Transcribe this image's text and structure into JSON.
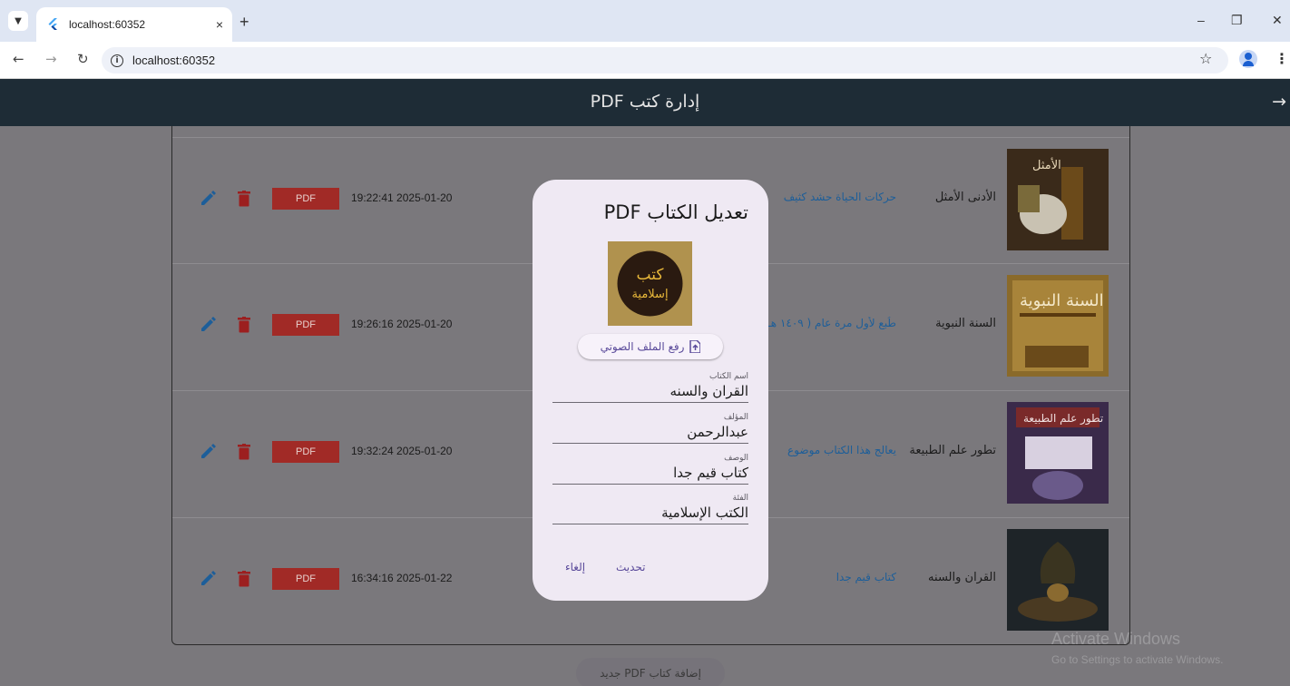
{
  "browser": {
    "tab_title": "localhost:60352",
    "tab_close": "×",
    "new_tab": "+",
    "url": "localhost:60352",
    "minimize": "–",
    "restore": "❐",
    "close": "✕"
  },
  "app": {
    "title": "إدارة كتب PDF",
    "back_arrow": "→"
  },
  "rows": [
    {
      "title": "الأدنى الأمثل",
      "description": "حركات الحياة حشد كثيف",
      "date": "19:22:41 2025-01-20",
      "pdf_label": "PDF"
    },
    {
      "title": "السنة النبوية",
      "description": "طُبع لأول مرة عام ( ١٤٠٩ هـ",
      "date": "19:26:16 2025-01-20",
      "pdf_label": "PDF"
    },
    {
      "title": "تطور علم الطبيعة",
      "description": "يعالج هذا الكتاب موضوع",
      "date": "19:32:24 2025-01-20",
      "pdf_label": "PDF"
    },
    {
      "title": "القران والسنه",
      "description": "كتاب قيم جدا",
      "date": "16:34:16 2025-01-22",
      "pdf_label": "PDF"
    }
  ],
  "add_button": "إضافة كتاب PDF جديد",
  "watermark": {
    "line1": "Activate Windows",
    "line2": "Go to Settings to activate Windows."
  },
  "dialog": {
    "title": "تعديل الكتاب PDF",
    "cover_text_line1": "كتب",
    "cover_text_line2": "إسلامية",
    "upload_label": "رفع الملف الصوتي",
    "fields": {
      "name": {
        "label": "اسم الكتاب",
        "value": "القران والسنه"
      },
      "author": {
        "label": "المؤلف",
        "value": "عبدالرحمن"
      },
      "description": {
        "label": "الوصف",
        "value": "كتاب قيم جدا"
      },
      "category": {
        "label": "الفئة",
        "value": "الكتب الإسلامية"
      }
    },
    "update_label": "تحديث",
    "cancel_label": "إلغاء"
  },
  "colors": {
    "appbar": "#1e2c36",
    "pdf_button": "#a12a26",
    "edit_icon": "#1d5e99",
    "delete_icon": "#9c1f1f",
    "dialog_bg": "#efe9f3",
    "accent": "#5a4a9a"
  }
}
